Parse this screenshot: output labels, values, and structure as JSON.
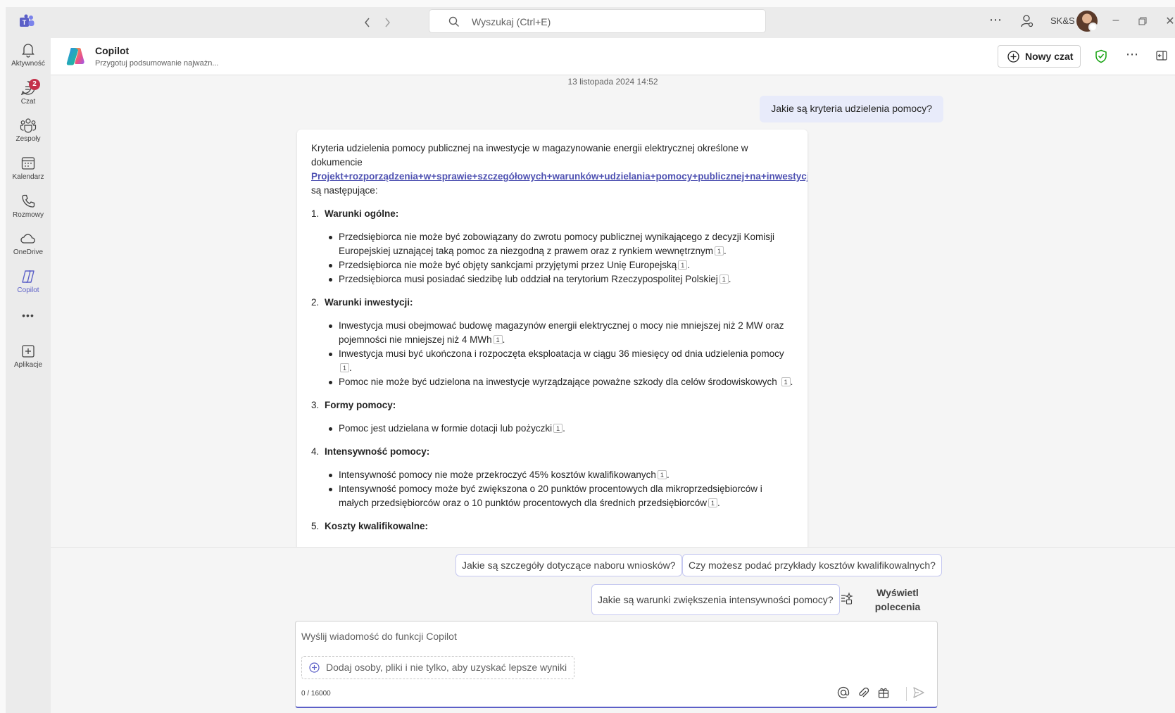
{
  "titlebar": {
    "search_placeholder": "Wyszukaj (Ctrl+E)",
    "org_label": "SK&S",
    "back_icon": "chevron-left-icon",
    "forward_icon": "chevron-right-icon",
    "more_label": "⋯",
    "minimize_label": "–",
    "restore_label": "❐",
    "close_label": "✕"
  },
  "rail": {
    "items": [
      {
        "label": "Aktywność",
        "icon": "bell-icon"
      },
      {
        "label": "Czat",
        "icon": "chat-icon",
        "badge": "2"
      },
      {
        "label": "Zespoły",
        "icon": "teams-icon"
      },
      {
        "label": "Kalendarz",
        "icon": "calendar-icon"
      },
      {
        "label": "Rozmowy",
        "icon": "phone-icon"
      },
      {
        "label": "OneDrive",
        "icon": "cloud-icon"
      },
      {
        "label": "Copilot",
        "icon": "copilot-icon"
      },
      {
        "label": "•••",
        "icon": "more-icon"
      },
      {
        "label": "Aplikacje",
        "icon": "apps-icon"
      }
    ]
  },
  "header": {
    "title": "Copilot",
    "subtitle": "Przygotuj podsumowanie najważn...",
    "new_chat_label": "Nowy czat",
    "more_label": "⋯"
  },
  "chat": {
    "timestamp": "13 listopada 2024 14:52",
    "user_message": "Jakie są kryteria udzielenia pomocy?",
    "bot": {
      "intro_before": "Kryteria udzielenia pomocy publicznej na inwestycje w magazynowanie energii elektrycznej określone w dokumencie",
      "link_text": "Projekt+rozporządzenia+w+sprawie+szczegółowych+warunków+udzielania+pomocy+publicznej+na+inwestycje+w+magazynowanie+energii+elektrycznej",
      "intro_after": " są następujące:",
      "ref_label": "1",
      "sections": [
        {
          "num": "1.",
          "title": "Warunki ogólne:",
          "items": [
            "Przedsiębiorca nie może być zobowiązany do zwrotu pomocy publicznej wynikającego z decyzji Komisji Europejskiej uznającej taką pomoc za niezgodną z prawem oraz z rynkiem wewnętrznym",
            "Przedsiębiorca nie może być objęty sankcjami przyjętymi przez Unię Europejską",
            "Przedsiębiorca musi posiadać siedzibę lub oddział na terytorium Rzeczypospolitej Polskiej"
          ]
        },
        {
          "num": "2.",
          "title": "Warunki inwestycji:",
          "items": [
            "Inwestycja musi obejmować budowę magazynów energii elektrycznej o mocy nie mniejszej niż 2 MW oraz pojemności nie mniejszej niż 4 MWh",
            "Inwestycja musi być ukończona i rozpoczęta eksploatacja w ciągu 36 miesięcy od dnia udzielenia pomocy",
            "Pomoc nie może być udzielona na inwestycje wyrządzające poważne szkody dla celów środowiskowych"
          ]
        },
        {
          "num": "3.",
          "title": "Formy pomocy:",
          "items": [
            "Pomoc jest udzielana w formie dotacji lub pożyczki"
          ]
        },
        {
          "num": "4.",
          "title": "Intensywność pomocy:",
          "items": [
            "Intensywność pomocy nie może przekroczyć 45% kosztów kwalifikowanych",
            "Intensywność pomocy może być zwiększona o 20 punktów procentowych dla mikroprzedsiębiorców i małych przedsiębiorców oraz o 10 punktów procentowych dla średnich przedsiębiorców"
          ]
        },
        {
          "num": "5.",
          "title": "Koszty kwalifikowalne:",
          "items": []
        }
      ]
    }
  },
  "suggestions": {
    "chips": [
      "Jakie są szczegóły dotyczące naboru wniosków?",
      "Czy możesz podać przykłady kosztów kwalifikowalnych?",
      "Jakie są warunki zwiększenia intensywności pomocy?"
    ],
    "show_prompts_line1": "Wyświetl",
    "show_prompts_line2": "polecenia"
  },
  "composer": {
    "placeholder": "Wyślij wiadomość do funkcji Copilot",
    "add_people": "Dodaj osoby, pliki i nie tylko, aby uzyskać lepsze wyniki",
    "char_count": "0 / 16000"
  },
  "colors": {
    "accent": "#5b5fc7",
    "badge": "#c4314b",
    "shield": "#13a10e"
  }
}
